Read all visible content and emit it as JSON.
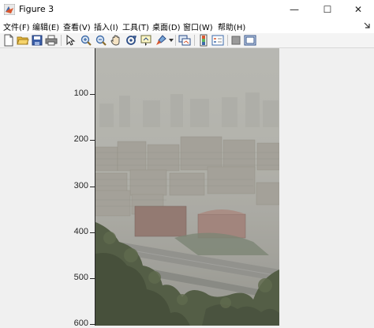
{
  "window": {
    "title": "Figure 3",
    "minimize": "—",
    "maximize": "☐",
    "close": "✕"
  },
  "menu": {
    "items": [
      "文件(F)",
      "编辑(E)",
      "查看(V)",
      "插入(I)",
      "工具(T)",
      "桌面(D)",
      "窗口(W)",
      "帮助(H)"
    ],
    "overflow_icon": "dock-arrow-icon"
  },
  "toolbar": {
    "buttons": [
      "new-figure-icon",
      "open-file-icon",
      "save-icon",
      "print-icon",
      "pointer-icon",
      "zoom-in-icon",
      "zoom-out-icon",
      "pan-hand-icon",
      "rotate-3d-icon",
      "data-cursor-icon",
      "brush-icon",
      "link-plot-icon",
      "colorbar-icon",
      "legend-icon",
      "hide-tools-icon",
      "dock-icon"
    ]
  },
  "axes": {
    "yticks": [
      "100",
      "200",
      "300",
      "400",
      "500",
      "600"
    ],
    "image_description": "hazy city skyline photo"
  },
  "colors": {
    "titlebar": "#ffffff",
    "canvas": "#f0f0f0",
    "axis": "#262626",
    "haze": "#b3b3ac"
  }
}
